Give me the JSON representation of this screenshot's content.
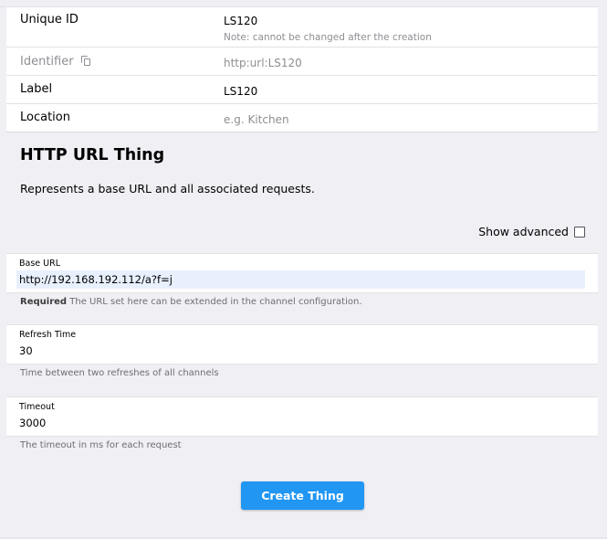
{
  "thing_info": {
    "unique_id_label": "Unique ID",
    "unique_id_value": "LS120",
    "unique_id_note": "Note: cannot be changed after the creation",
    "identifier_label": "Identifier",
    "identifier_value": "http:url:LS120",
    "label_label": "Label",
    "label_value": "LS120",
    "location_label": "Location",
    "location_placeholder": "e.g. Kitchen"
  },
  "binding": {
    "title": "HTTP URL Thing",
    "description": "Represents a base URL and all associated requests."
  },
  "show_advanced": {
    "label": "Show advanced",
    "checked": false
  },
  "config": {
    "base_url": {
      "label": "Base URL",
      "value": "http://192.168.192.112/a?f=j",
      "hint_required": "Required",
      "hint": "The URL set here can be extended in the channel configuration."
    },
    "refresh_time": {
      "label": "Refresh Time",
      "value": "30",
      "hint": "Time between two refreshes of all channels"
    },
    "timeout": {
      "label": "Timeout",
      "value": "3000",
      "hint": "The timeout in ms for each request"
    }
  },
  "actions": {
    "create_label": "Create Thing"
  },
  "colors": {
    "accent": "#2196f3",
    "background": "#efeff4",
    "active_input": "#e8f0fe"
  }
}
